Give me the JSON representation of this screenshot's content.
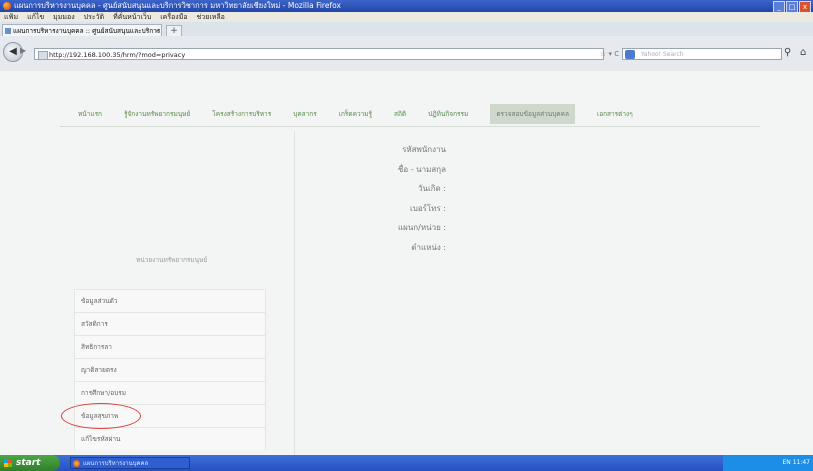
{
  "window": {
    "title": "แผนการบริหารงานบุคคล - ศูนย์สนับสนุนและบริการวิชาการ มหาวิทยาลัยเชียงใหม่ - Mozilla Firefox",
    "min_label": "_",
    "max_label": "□",
    "close_label": "x"
  },
  "menu": [
    "แฟ้ม",
    "แก้ไข",
    "มุมมอง",
    "ประวัติ",
    "ที่คั่นหน้าเว็บ",
    "เครื่องมือ",
    "ช่วยเหลือ"
  ],
  "tab": {
    "title": "แผนการบริหารงานบุคคล :: ศูนย์สนับสนุนและบริการ...",
    "close": "x",
    "new": "+"
  },
  "address": {
    "url": "http://192.168.100.35/hrm/?mod=privacy",
    "buttons": "☆ ▾ C"
  },
  "search": {
    "placeholder": "Yahoo! Search"
  },
  "site_nav": [
    {
      "label": "หน้าแรก",
      "active": false
    },
    {
      "label": "รู้จักงานทรัพยากรมนุษย์",
      "active": false
    },
    {
      "label": "โครงสร้างการบริหาร",
      "active": false
    },
    {
      "label": "บุคลากร",
      "active": false
    },
    {
      "label": "เกร็ดความรู้",
      "active": false
    },
    {
      "label": "สถิติ",
      "active": false
    },
    {
      "label": "ปฏิทินกิจกรรม",
      "active": false
    },
    {
      "label": "ตรวจสอบข้อมูลส่วนบุคคล",
      "active": true
    },
    {
      "label": "เอกสารต่างๆ",
      "active": false
    }
  ],
  "sidebar": {
    "title": "หน่วยงานทรัพยากรมนุษย์",
    "items": [
      {
        "label": "ข้อมูลส่วนตัว",
        "highlighted": false
      },
      {
        "label": "สวัสดิการ",
        "highlighted": false
      },
      {
        "label": "สิทธิการลา",
        "highlighted": false
      },
      {
        "label": "ญาติสายตรง",
        "highlighted": false
      },
      {
        "label": "การศึกษา/อบรม",
        "highlighted": false
      },
      {
        "label": "ข้อมูลสุขภาพ",
        "highlighted": true
      },
      {
        "label": "แก้ไขรหัสผ่าน",
        "highlighted": false
      }
    ]
  },
  "profile": {
    "employee_id": "รหัสพนักงาน",
    "name": "ชื่อ - นามสกุล",
    "birthdate": "วันเกิด :",
    "phone": "เบอร์โทร :",
    "department": "แผนก/หน่วย :",
    "position": "ตำแหน่ง :"
  },
  "taskbar": {
    "start": "start",
    "item": "แผนการบริหารงานบุคคล",
    "tray": "EN 11:47"
  },
  "colors": {
    "nav_text": "#5a8a4a",
    "nav_active_bg": "#cfd8cc",
    "circle_annotation": "#d6453c",
    "titlebar": "#2a50b8",
    "taskbar": "#2d5fd0"
  }
}
